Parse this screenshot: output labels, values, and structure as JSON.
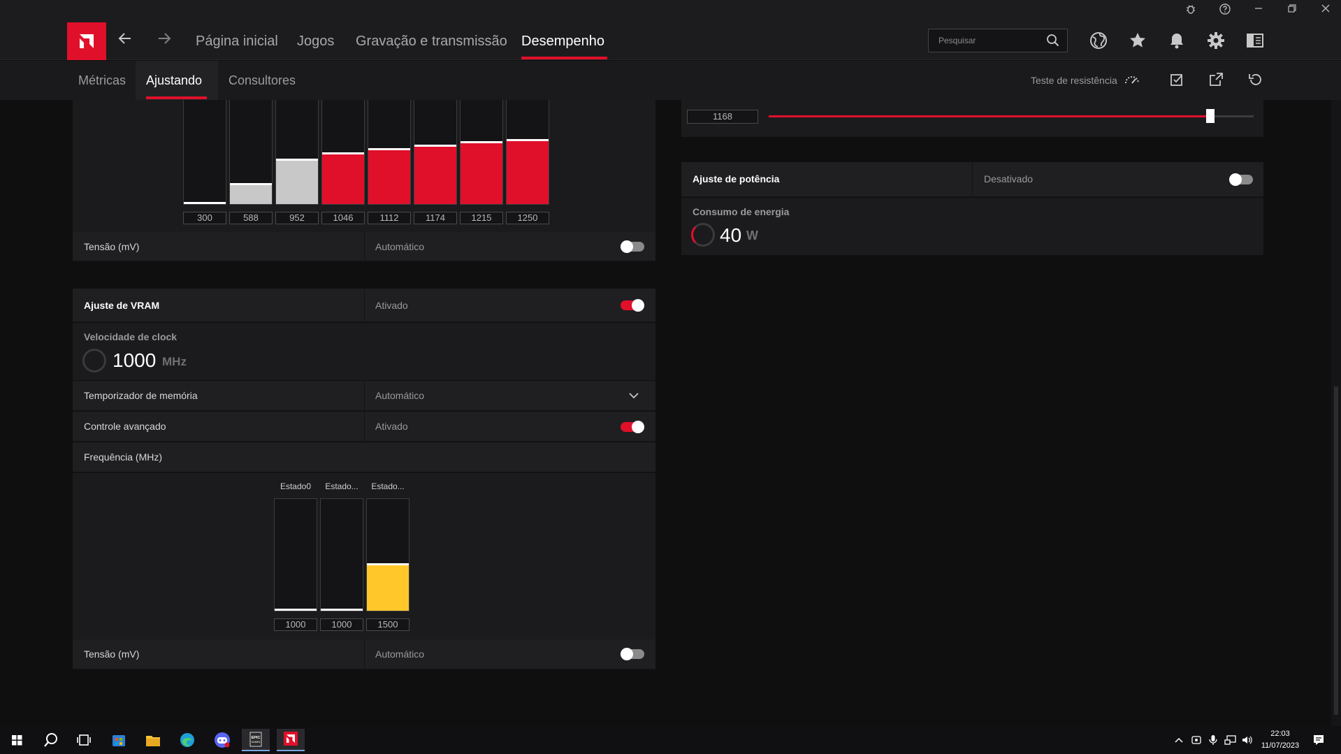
{
  "nav": {
    "home": "Página inicial",
    "games": "Jogos",
    "recording": "Gravação e transmissão",
    "performance": "Desempenho"
  },
  "search": {
    "placeholder": "Pesquisar"
  },
  "subnav": {
    "metrics": "Métricas",
    "tuning": "Ajustando",
    "advisors": "Consultores",
    "stress_test": "Teste de resistência"
  },
  "gpu_curve": {
    "values": [
      "300",
      "588",
      "952",
      "1046",
      "1112",
      "1174",
      "1215",
      "1250"
    ],
    "fill_fraction": [
      0.02,
      0.2,
      0.43,
      0.49,
      0.53,
      0.57,
      0.6,
      0.62
    ],
    "fill_colors": [
      "#141416",
      "#c8c8c8",
      "#c8c8c8",
      "#e0102b",
      "#e0102b",
      "#e0102b",
      "#e0102b",
      "#e0102b"
    ],
    "voltage_label": "Tensão (mV)",
    "voltage_value": "Automático"
  },
  "max_freq": {
    "value": "1168",
    "slider_fraction": 0.91
  },
  "power": {
    "label": "Ajuste de potência",
    "value": "Desativado",
    "consumption_label": "Consumo de energia",
    "consumption_value": "40",
    "consumption_unit": "W"
  },
  "vram": {
    "label": "Ajuste de VRAM",
    "value": "Ativado",
    "clock_label": "Velocidade de clock",
    "clock_value": "1000",
    "clock_unit": "MHz",
    "timing_label": "Temporizador de memória",
    "timing_value": "Automático",
    "advanced_label": "Controle avançado",
    "advanced_value": "Ativado",
    "freq_label": "Frequência (MHz)",
    "states": [
      "Estado0",
      "Estado...",
      "Estado..."
    ],
    "state_values": [
      "1000",
      "1000",
      "1500"
    ],
    "state_fill_fraction": [
      0.02,
      0.02,
      0.42
    ],
    "state_colors": [
      "#141416",
      "#141416",
      "#ffc72a"
    ],
    "voltage_label": "Tensão (mV)",
    "voltage_value": "Automático"
  },
  "taskbar": {
    "time": "22:03",
    "date": "11/07/2023"
  },
  "colors": {
    "accent": "#e0102b",
    "vram_state": "#ffc72a"
  }
}
